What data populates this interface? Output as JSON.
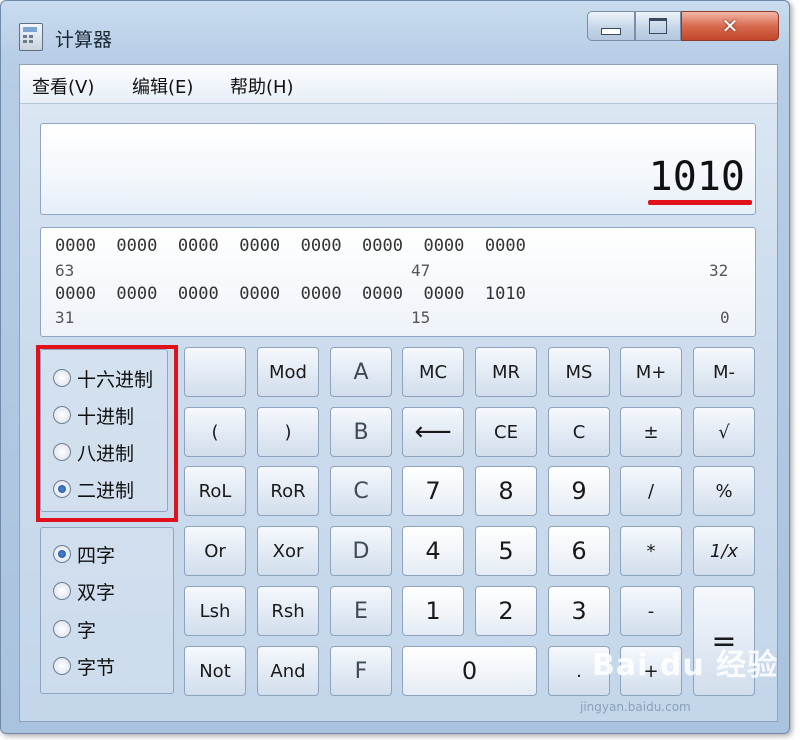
{
  "window": {
    "title": "计算器",
    "close_glyph": "✕"
  },
  "menu": [
    "查看(V)",
    "编辑(E)",
    "帮助(H)"
  ],
  "display": {
    "value": "1010"
  },
  "bits": {
    "row1": "0000  0000  0000  0000  0000  0000  0000  0000",
    "row1_idx": [
      "63",
      "47",
      "32"
    ],
    "row2": "0000  0000  0000  0000  0000  0000  0000  1010",
    "row2_idx": [
      "31",
      "15",
      "0"
    ]
  },
  "base": {
    "options": [
      "十六进制",
      "十进制",
      "八进制",
      "二进制"
    ],
    "selected": "二进制"
  },
  "word": {
    "options": [
      "四字",
      "双字",
      "字",
      "字节"
    ],
    "selected": "四字"
  },
  "keys": {
    "r1": [
      "",
      "Mod",
      "A",
      "MC",
      "MR",
      "MS",
      "M+",
      "M-"
    ],
    "r2": [
      "(",
      ")",
      "B",
      "⟵",
      "CE",
      "C",
      "±",
      "√"
    ],
    "r3": [
      "RoL",
      "RoR",
      "C",
      "7",
      "8",
      "9",
      "/",
      "%"
    ],
    "r4": [
      "Or",
      "Xor",
      "D",
      "4",
      "5",
      "6",
      "*",
      "1/x"
    ],
    "r5": [
      "Lsh",
      "Rsh",
      "E",
      "1",
      "2",
      "3",
      "-",
      "="
    ],
    "r6": [
      "Not",
      "And",
      "F",
      "0",
      ".",
      "+"
    ]
  },
  "watermark": {
    "text": "Bai du 经验",
    "sub": "jingyan.baidu.com"
  },
  "colors": {
    "highlight": "#e0111b",
    "accent": "#1d4f99"
  }
}
